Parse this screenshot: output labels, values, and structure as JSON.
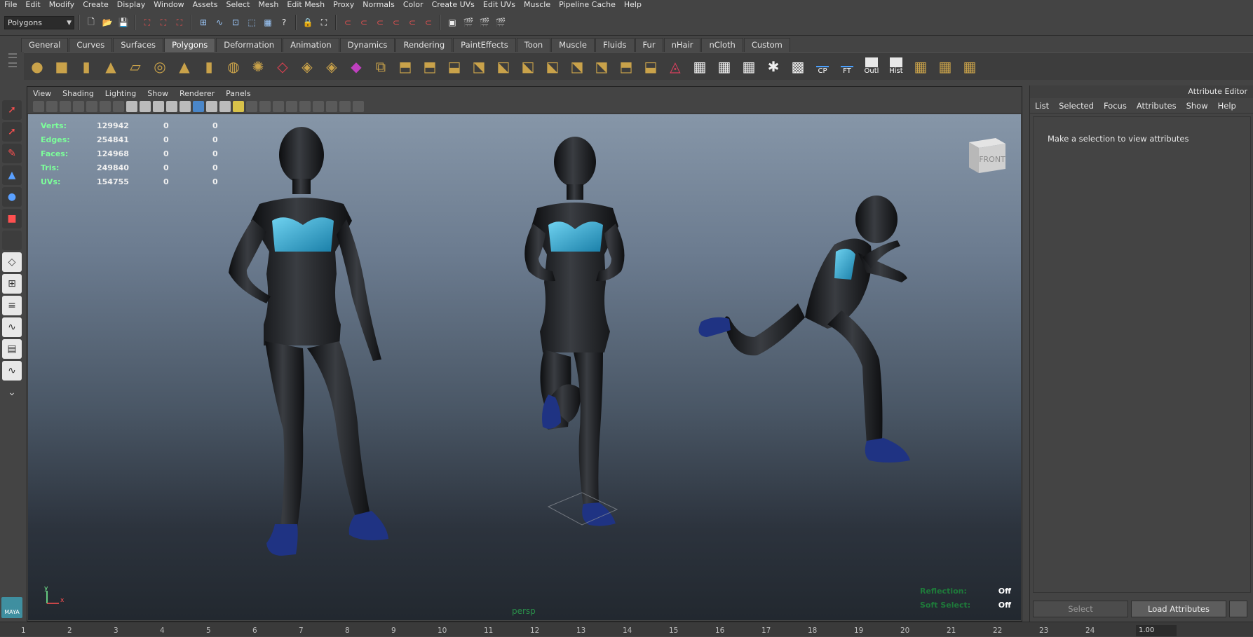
{
  "menubar": [
    "File",
    "Edit",
    "Modify",
    "Create",
    "Display",
    "Window",
    "Assets",
    "Select",
    "Mesh",
    "Edit Mesh",
    "Proxy",
    "Normals",
    "Color",
    "Create UVs",
    "Edit UVs",
    "Muscle",
    "Pipeline Cache",
    "Help"
  ],
  "status_line": {
    "mode": "Polygons"
  },
  "shelf_tabs": [
    "General",
    "Curves",
    "Surfaces",
    "Polygons",
    "Deformation",
    "Animation",
    "Dynamics",
    "Rendering",
    "PaintEffects",
    "Toon",
    "Muscle",
    "Fluids",
    "Fur",
    "nHair",
    "nCloth",
    "Custom"
  ],
  "shelf_active_tab": "Polygons",
  "shelf_icon_labels": {
    "cp": "CP",
    "ft": "FT",
    "outl": "Outl",
    "hist": "Hist"
  },
  "viewport": {
    "panel_menu": [
      "View",
      "Shading",
      "Lighting",
      "Show",
      "Renderer",
      "Panels"
    ],
    "heads_up": [
      {
        "label": "Verts:",
        "v1": "129942",
        "v2": "0",
        "v3": "0"
      },
      {
        "label": "Edges:",
        "v1": "254841",
        "v2": "0",
        "v3": "0"
      },
      {
        "label": "Faces:",
        "v1": "124968",
        "v2": "0",
        "v3": "0"
      },
      {
        "label": "Tris:",
        "v1": "249840",
        "v2": "0",
        "v3": "0"
      },
      {
        "label": "UVs:",
        "v1": "154755",
        "v2": "0",
        "v3": "0"
      }
    ],
    "viewcube_label": "FRONT",
    "camera": "persp",
    "reflection_label": "Reflection:",
    "reflection_value": "Off",
    "soft_select_label": "Soft Select:",
    "soft_select_value": "Off",
    "axis_y": "y",
    "axis_x": "x"
  },
  "attribute_editor": {
    "title": "Attribute Editor",
    "menu": [
      "List",
      "Selected",
      "Focus",
      "Attributes",
      "Show",
      "Help"
    ],
    "message": "Make a selection to view attributes",
    "select_button": "Select",
    "load_button": "Load Attributes"
  },
  "timeline": {
    "ticks": [
      "1",
      "2",
      "3",
      "4",
      "5",
      "6",
      "7",
      "8",
      "9",
      "10",
      "11",
      "12",
      "13",
      "14",
      "15",
      "16",
      "17",
      "18",
      "19",
      "20",
      "21",
      "22",
      "23",
      "24"
    ],
    "current_field": "1.00"
  },
  "colors": {
    "hud_label": "#7cff9a",
    "bg_top": "#8696a8",
    "bg_bottom": "#22282f",
    "body": "#1b1d20",
    "top": "#3fb4dc",
    "shoe": "#1d2f7a"
  }
}
